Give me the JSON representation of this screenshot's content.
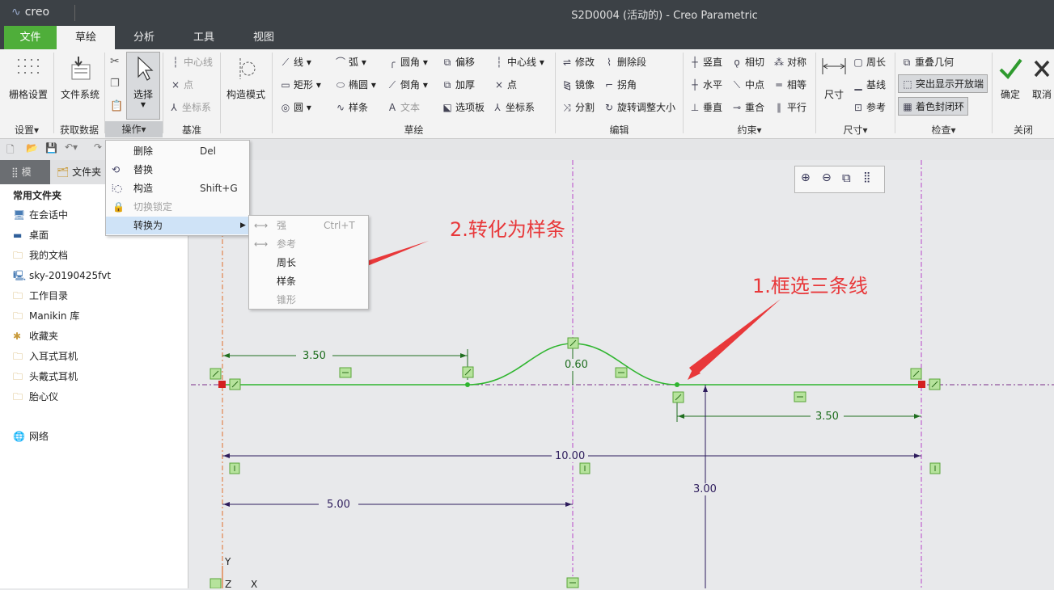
{
  "window": {
    "logo": "creo",
    "title": "S2D0004 (活动的) - Creo Parametric"
  },
  "menu_tabs": [
    "文件",
    "草绘",
    "分析",
    "工具",
    "视图"
  ],
  "ribbon": {
    "grid_settings": "栅格设置",
    "file_system": "文件系统",
    "select": "选择",
    "centerline_datum": "中心线",
    "point_datum": "点",
    "csys_datum": "坐标系",
    "construction_mode": "构造模式",
    "line": "线",
    "rectangle": "矩形",
    "circle": "圆",
    "arc": "弧",
    "ellipse": "椭圆",
    "spline": "样条",
    "fillet": "圆角",
    "chamfer": "倒角",
    "text": "文本",
    "offset": "偏移",
    "thicken": "加厚",
    "palette": "选项板",
    "centerline": "中心线",
    "point": "点",
    "csys": "坐标系",
    "modify": "修改",
    "mirror": "镜像",
    "divide": "分割",
    "delete_segment": "删除段",
    "corner": "拐角",
    "rotate_resize": "旋转调整大小",
    "vertical": "竖直",
    "horizontal": "水平",
    "perpendicular": "垂直",
    "tangent": "相切",
    "midpoint": "中点",
    "coincident": "重合",
    "symmetric": "对称",
    "equal": "相等",
    "parallel": "平行",
    "dimension": "尺寸",
    "perimeter": "周长",
    "baseline": "基线",
    "reference": "参考",
    "overlapping_geometry": "重叠几何",
    "highlight_open_ends": "突出显示开放端",
    "shade_closed_loops": "着色封闭环",
    "ok": "确定",
    "cancel": "取消"
  },
  "groups": {
    "setup": "设置",
    "get_data": "获取数据",
    "operations": "操作",
    "datum": "基准",
    "sketching": "草绘",
    "editing": "编辑",
    "constrain": "约束",
    "dimension": "尺寸",
    "inspect": "检查",
    "close": "关闭"
  },
  "context_menu": {
    "items": [
      {
        "label": "删除",
        "shortcut": "Del"
      },
      {
        "label": "替换",
        "shortcut": ""
      },
      {
        "label": "构造",
        "shortcut": "Shift+G"
      },
      {
        "label": "切换锁定",
        "shortcut": ""
      },
      {
        "label": "转换为",
        "shortcut": ""
      }
    ]
  },
  "submenu": {
    "items": [
      {
        "label": "强",
        "shortcut": "Ctrl+T"
      },
      {
        "label": "参考",
        "shortcut": ""
      },
      {
        "label": "周长",
        "shortcut": ""
      },
      {
        "label": "样条",
        "shortcut": ""
      },
      {
        "label": "锥形",
        "shortcut": ""
      }
    ]
  },
  "left_panel": {
    "tab_model": "模",
    "tab_folder": "文件夹",
    "heading": "常用文件夹",
    "items": [
      "在会话中",
      "桌面",
      "我的文档",
      "sky-20190425fvt",
      "工作目录",
      "Manikin 库",
      "收藏夹",
      "入耳式耳机",
      "头戴式耳机",
      "胎心仪"
    ],
    "network": "网络"
  },
  "dimensions": {
    "left_length": "3.50",
    "bump_height": "0.60",
    "right_length": "3.50",
    "total_length": "10.00",
    "half_length": "5.00",
    "vertical": "3.00"
  },
  "annotations": {
    "step1": "1.框选三条线",
    "step2": "2.转化为样条"
  },
  "axis": {
    "y": "Y",
    "z": "Z",
    "x": "X"
  },
  "colors": {
    "file_tab": "#4fae3a",
    "sketch_line": "#2fb52f",
    "dim": "#1f6e1f",
    "annotation": "#e8383a",
    "menu_highlight": "#cfe3f7"
  }
}
